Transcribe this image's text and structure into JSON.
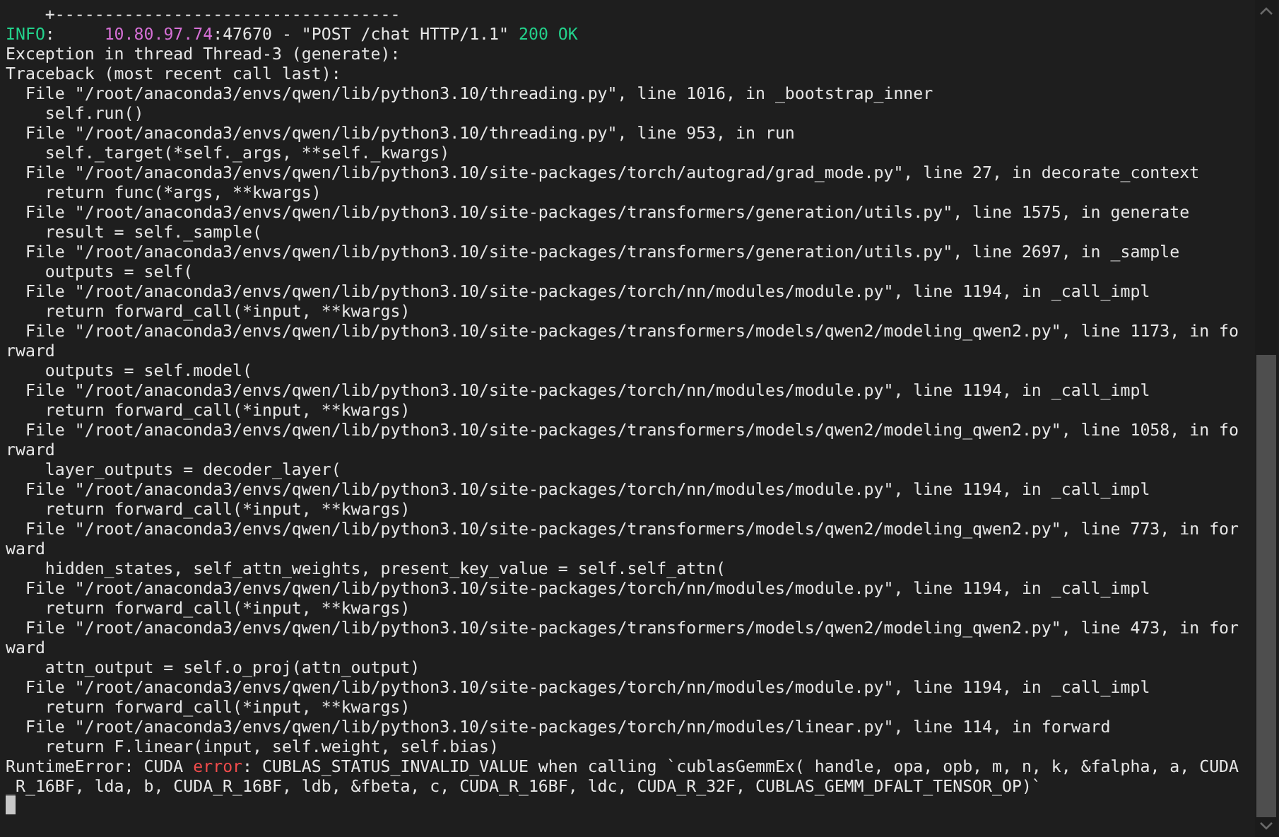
{
  "terminal": {
    "lines": [
      [
        {
          "kind": "plain",
          "text": "    +-----------------------------------"
        }
      ],
      [
        {
          "kind": "info",
          "text": "INFO"
        },
        {
          "kind": "plain",
          "text": ":     "
        },
        {
          "kind": "address",
          "text": "10.80.97.74"
        },
        {
          "kind": "plain",
          "text": ":47670 - \"POST /chat HTTP/1.1\" "
        },
        {
          "kind": "status",
          "text": "200 OK"
        }
      ],
      [
        {
          "kind": "plain",
          "text": "Exception in thread Thread-3 (generate):"
        }
      ],
      [
        {
          "kind": "plain",
          "text": "Traceback (most recent call last):"
        }
      ],
      [
        {
          "kind": "plain",
          "text": "  File \"/root/anaconda3/envs/qwen/lib/python3.10/threading.py\", line 1016, in _bootstrap_inner"
        }
      ],
      [
        {
          "kind": "plain",
          "text": "    self.run()"
        }
      ],
      [
        {
          "kind": "plain",
          "text": "  File \"/root/anaconda3/envs/qwen/lib/python3.10/threading.py\", line 953, in run"
        }
      ],
      [
        {
          "kind": "plain",
          "text": "    self._target(*self._args, **self._kwargs)"
        }
      ],
      [
        {
          "kind": "plain",
          "text": "  File \"/root/anaconda3/envs/qwen/lib/python3.10/site-packages/torch/autograd/grad_mode.py\", line 27, in decorate_context"
        }
      ],
      [
        {
          "kind": "plain",
          "text": "    return func(*args, **kwargs)"
        }
      ],
      [
        {
          "kind": "plain",
          "text": "  File \"/root/anaconda3/envs/qwen/lib/python3.10/site-packages/transformers/generation/utils.py\", line 1575, in generate"
        }
      ],
      [
        {
          "kind": "plain",
          "text": "    result = self._sample("
        }
      ],
      [
        {
          "kind": "plain",
          "text": "  File \"/root/anaconda3/envs/qwen/lib/python3.10/site-packages/transformers/generation/utils.py\", line 2697, in _sample"
        }
      ],
      [
        {
          "kind": "plain",
          "text": "    outputs = self("
        }
      ],
      [
        {
          "kind": "plain",
          "text": "  File \"/root/anaconda3/envs/qwen/lib/python3.10/site-packages/torch/nn/modules/module.py\", line 1194, in _call_impl"
        }
      ],
      [
        {
          "kind": "plain",
          "text": "    return forward_call(*input, **kwargs)"
        }
      ],
      [
        {
          "kind": "plain",
          "text": "  File \"/root/anaconda3/envs/qwen/lib/python3.10/site-packages/transformers/models/qwen2/modeling_qwen2.py\", line 1173, in fo"
        }
      ],
      [
        {
          "kind": "plain",
          "text": "rward"
        }
      ],
      [
        {
          "kind": "plain",
          "text": "    outputs = self.model("
        }
      ],
      [
        {
          "kind": "plain",
          "text": "  File \"/root/anaconda3/envs/qwen/lib/python3.10/site-packages/torch/nn/modules/module.py\", line 1194, in _call_impl"
        }
      ],
      [
        {
          "kind": "plain",
          "text": "    return forward_call(*input, **kwargs)"
        }
      ],
      [
        {
          "kind": "plain",
          "text": "  File \"/root/anaconda3/envs/qwen/lib/python3.10/site-packages/transformers/models/qwen2/modeling_qwen2.py\", line 1058, in fo"
        }
      ],
      [
        {
          "kind": "plain",
          "text": "rward"
        }
      ],
      [
        {
          "kind": "plain",
          "text": "    layer_outputs = decoder_layer("
        }
      ],
      [
        {
          "kind": "plain",
          "text": "  File \"/root/anaconda3/envs/qwen/lib/python3.10/site-packages/torch/nn/modules/module.py\", line 1194, in _call_impl"
        }
      ],
      [
        {
          "kind": "plain",
          "text": "    return forward_call(*input, **kwargs)"
        }
      ],
      [
        {
          "kind": "plain",
          "text": "  File \"/root/anaconda3/envs/qwen/lib/python3.10/site-packages/transformers/models/qwen2/modeling_qwen2.py\", line 773, in for"
        }
      ],
      [
        {
          "kind": "plain",
          "text": "ward"
        }
      ],
      [
        {
          "kind": "plain",
          "text": "    hidden_states, self_attn_weights, present_key_value = self.self_attn("
        }
      ],
      [
        {
          "kind": "plain",
          "text": "  File \"/root/anaconda3/envs/qwen/lib/python3.10/site-packages/torch/nn/modules/module.py\", line 1194, in _call_impl"
        }
      ],
      [
        {
          "kind": "plain",
          "text": "    return forward_call(*input, **kwargs)"
        }
      ],
      [
        {
          "kind": "plain",
          "text": "  File \"/root/anaconda3/envs/qwen/lib/python3.10/site-packages/transformers/models/qwen2/modeling_qwen2.py\", line 473, in for"
        }
      ],
      [
        {
          "kind": "plain",
          "text": "ward"
        }
      ],
      [
        {
          "kind": "plain",
          "text": "    attn_output = self.o_proj(attn_output)"
        }
      ],
      [
        {
          "kind": "plain",
          "text": "  File \"/root/anaconda3/envs/qwen/lib/python3.10/site-packages/torch/nn/modules/module.py\", line 1194, in _call_impl"
        }
      ],
      [
        {
          "kind": "plain",
          "text": "    return forward_call(*input, **kwargs)"
        }
      ],
      [
        {
          "kind": "plain",
          "text": "  File \"/root/anaconda3/envs/qwen/lib/python3.10/site-packages/torch/nn/modules/linear.py\", line 114, in forward"
        }
      ],
      [
        {
          "kind": "plain",
          "text": "    return F.linear(input, self.weight, self.bias)"
        }
      ],
      [
        {
          "kind": "plain",
          "text": "RuntimeError: CUDA "
        },
        {
          "kind": "error",
          "text": "error"
        },
        {
          "kind": "plain",
          "text": ": CUBLAS_STATUS_INVALID_VALUE when calling `cublasGemmEx( handle, opa, opb, m, n, k, &falpha, a, CUDA"
        }
      ],
      [
        {
          "kind": "plain",
          "text": "_R_16BF, lda, b, CUDA_R_16BF, ldb, &fbeta, c, CUDA_R_16BF, ldc, CUDA_R_32F, CUBLAS_GEMM_DFALT_TENSOR_OP)`"
        }
      ]
    ]
  }
}
